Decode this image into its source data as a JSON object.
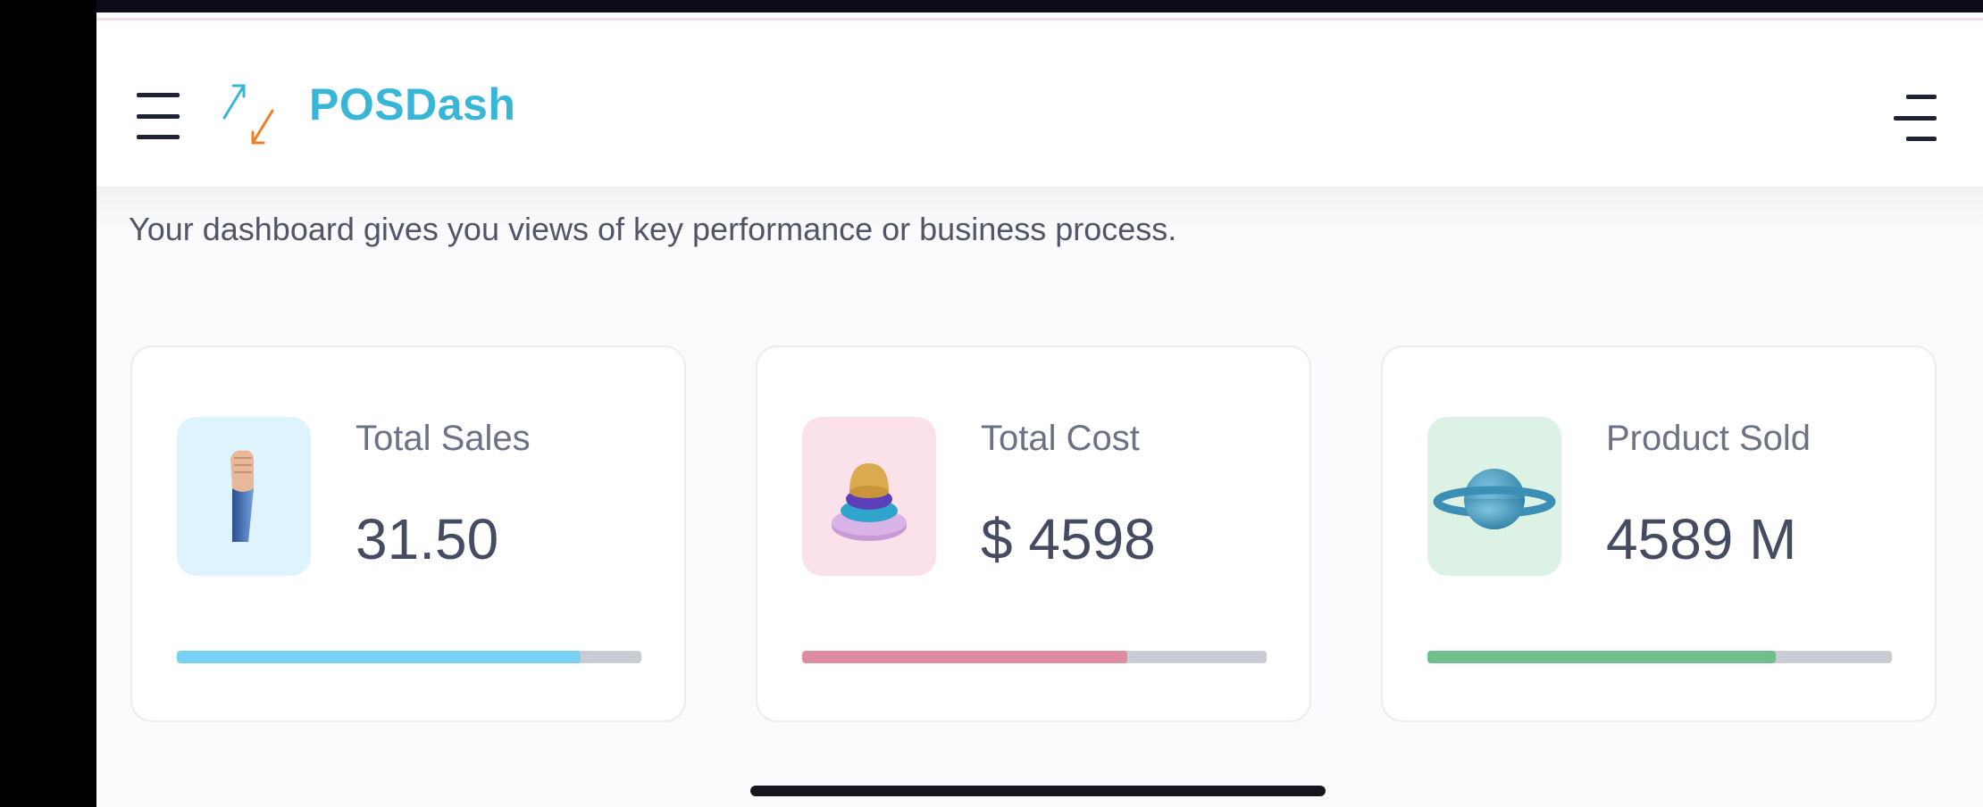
{
  "app": {
    "brand": "POSDash"
  },
  "page": {
    "subtitle": "Your dashboard gives you views of key performance or business process."
  },
  "cards": [
    {
      "label": "Total Sales",
      "value": "31.50",
      "progress_percent": 87,
      "icon_bg": "#dff3fd",
      "bar_color": "#78d1f2"
    },
    {
      "label": "Total Cost",
      "value": "$ 4598",
      "progress_percent": 70,
      "icon_bg": "#fbe1ea",
      "bar_color": "#de8aa1"
    },
    {
      "label": "Product Sold",
      "value": "4589 M",
      "progress_percent": 75,
      "icon_bg": "#dcf2e4",
      "bar_color": "#6fbe8e"
    }
  ],
  "icons": {
    "menu": "hamburger-menu-icon",
    "logo": "up-down-arrows-logo-icon",
    "right_menu": "right-aligned-menu-icon",
    "card_0": "raised-fist-3d-icon",
    "card_1": "stacked-rings-3d-icon",
    "card_2": "planet-3d-icon"
  }
}
